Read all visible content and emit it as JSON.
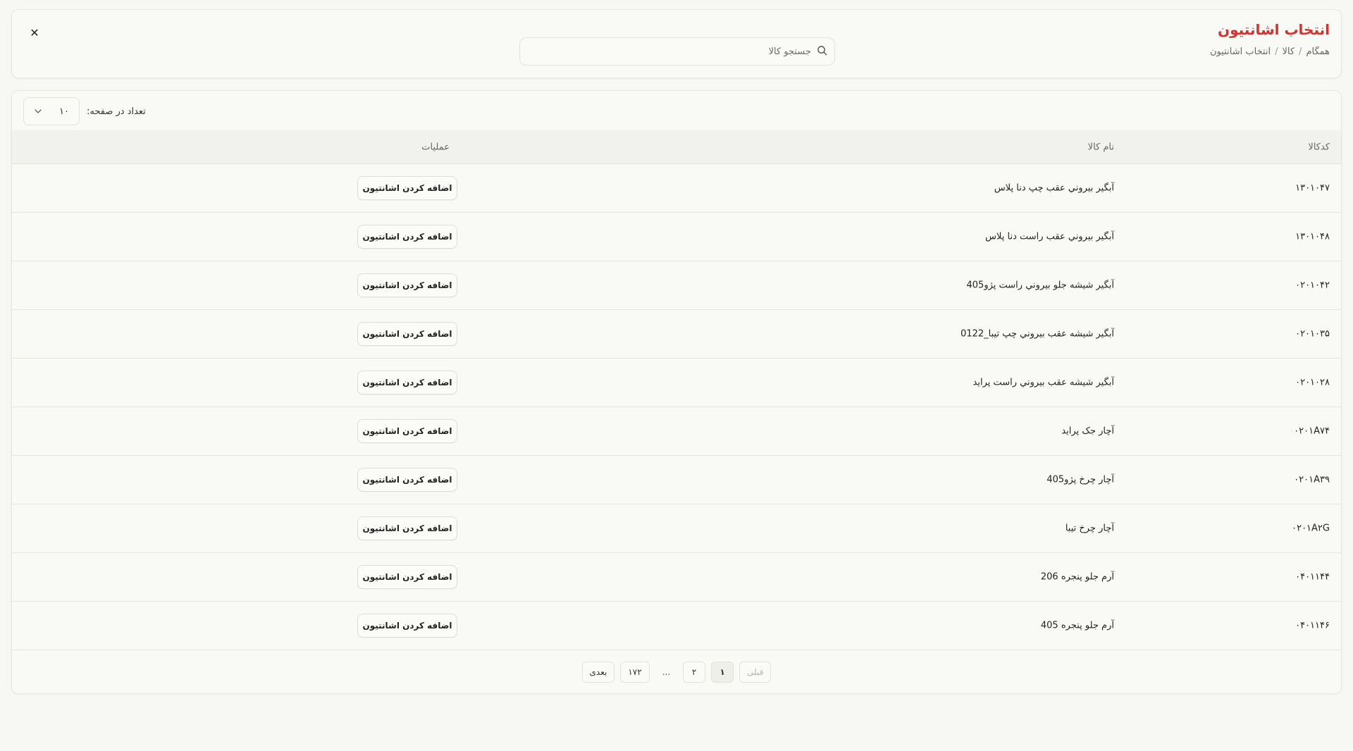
{
  "header": {
    "title": "انتخاب اشانتیون",
    "breadcrumb": [
      "همگام",
      "کالا",
      "انتخاب اشانتیون"
    ],
    "breadcrumb_separator": "/",
    "search_placeholder": "جستجو کالا",
    "close_label": "✕"
  },
  "per_page": {
    "label": "تعداد در صفحه:",
    "value": "۱۰"
  },
  "table": {
    "columns": {
      "code": "کدکالا",
      "name": "نام کالا",
      "ops": "عملیات"
    },
    "action_label": "اضافه کردن اشانتیون",
    "rows": [
      {
        "code": "۱۳۰۱۰۴۷",
        "name": "آبگير بيروني عقب چپ دنا پلاس"
      },
      {
        "code": "۱۳۰۱۰۴۸",
        "name": "آبگير بيروني عقب راست دنا پلاس"
      },
      {
        "code": "۰۲۰۱۰۴۲",
        "name": "آبگير شيشه جلو بيروني راست پژو405"
      },
      {
        "code": "۰۲۰۱۰۳۵",
        "name": "آبگير شيشه عقب بيروني چپ تيبا_0122"
      },
      {
        "code": "۰۲۰۱۰۲۸",
        "name": "آبگير شيشه عقب بيروني راست پرايد"
      },
      {
        "code": "۰۲۰۱A۷۴",
        "name": "آچار جک پرايد"
      },
      {
        "code": "۰۲۰۱A۳۹",
        "name": "آچار چرخ پژو405"
      },
      {
        "code": "۰۲۰۱A۲G",
        "name": "آچار چرخ تيبا"
      },
      {
        "code": "۰۴۰۱۱۴۴",
        "name": "آرم جلو پنجره 206"
      },
      {
        "code": "۰۴۰۱۱۴۶",
        "name": "آرم جلو پنجره 405"
      }
    ]
  },
  "pagination": {
    "prev": "قبلی",
    "pages": [
      "۱",
      "۲"
    ],
    "ellipsis": "...",
    "last": "۱۷۲",
    "next": "بعدی"
  }
}
